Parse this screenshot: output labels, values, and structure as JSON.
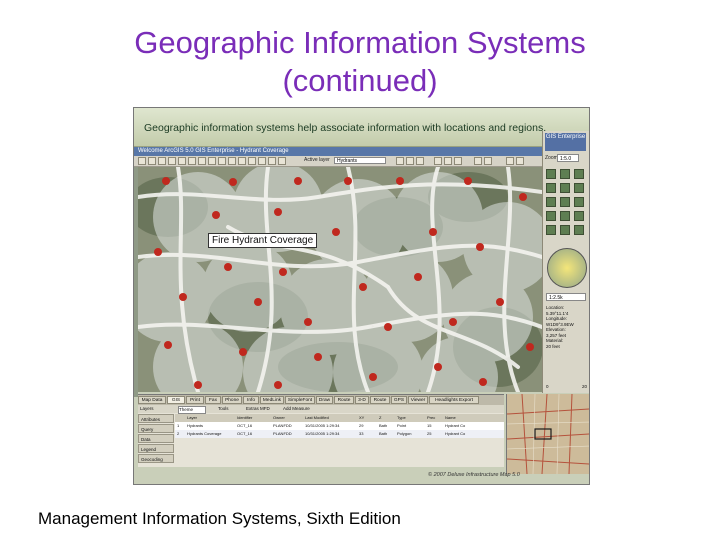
{
  "slide": {
    "title_line1": "Geographic Information Systems",
    "title_line2": "(continued)",
    "footer": "Management Information Systems, Sixth Edition"
  },
  "screenshot": {
    "banner": "Geographic information systems help associate information with locations and regions.",
    "window_title": "Welcome ArcGIS 5.0 GIS Enterprise - Hydrant Coverage",
    "active_layer_label": "Active layer",
    "active_layer_value": "Hydrants",
    "map_label": "Fire Hydrant Coverage",
    "colors": {
      "title": "#7a2db8",
      "titlebar": "#5877a8",
      "hydrant": "#c0281e"
    },
    "right_panel": {
      "logo": "GIS Enterprise",
      "zoom_label": "Zoom",
      "zoom_value": "1:5.0",
      "scale": "1:2.5k",
      "info": [
        "Location:",
        "5.39°11.1'4",
        "Longitude:",
        "W1D9°3.9EW",
        "Elevation:",
        "3,257 feet",
        "Material:",
        "20 feet"
      ],
      "slider_min": "0",
      "slider_max": "20"
    },
    "tabs": [
      "Map Data",
      "GIS",
      "Print",
      "Fax",
      "Phone",
      "Info",
      "MedLink",
      "SimpleFont",
      "Draw",
      "Route",
      "3-D",
      "Route",
      "GPS",
      "Viewer",
      "Headlights Export"
    ],
    "controls": {
      "layer_label": "Layers",
      "layer_value": "Theme",
      "tools": "Tools",
      "edit": "Extras MFD",
      "add": "Add Measure"
    },
    "side_buttons": [
      "Attributes",
      "Query",
      "Data",
      "Legend",
      "Geocoding"
    ],
    "table": {
      "headers": [
        "",
        "Layer",
        "Identifier",
        "Owner",
        "Last Modified",
        "XY",
        "Z",
        "Type",
        "Prec",
        "Name"
      ],
      "rows": [
        [
          "1",
          "Hydrants",
          "OCT_16",
          "PLANFDD",
          "10/31/2005 1:29:34",
          "29",
          "Bath",
          "Point",
          "15",
          "Hydrant Co"
        ],
        [
          "2",
          "Hydrants Coverage",
          "OCT_16",
          "PLANFDD",
          "10/31/2005 1:29:34",
          "33",
          "Bath",
          "Polygon",
          "25",
          "Hydrant Co"
        ]
      ]
    },
    "copyright": "© 2007 Deluxe Infrastructure Map 5.0"
  }
}
